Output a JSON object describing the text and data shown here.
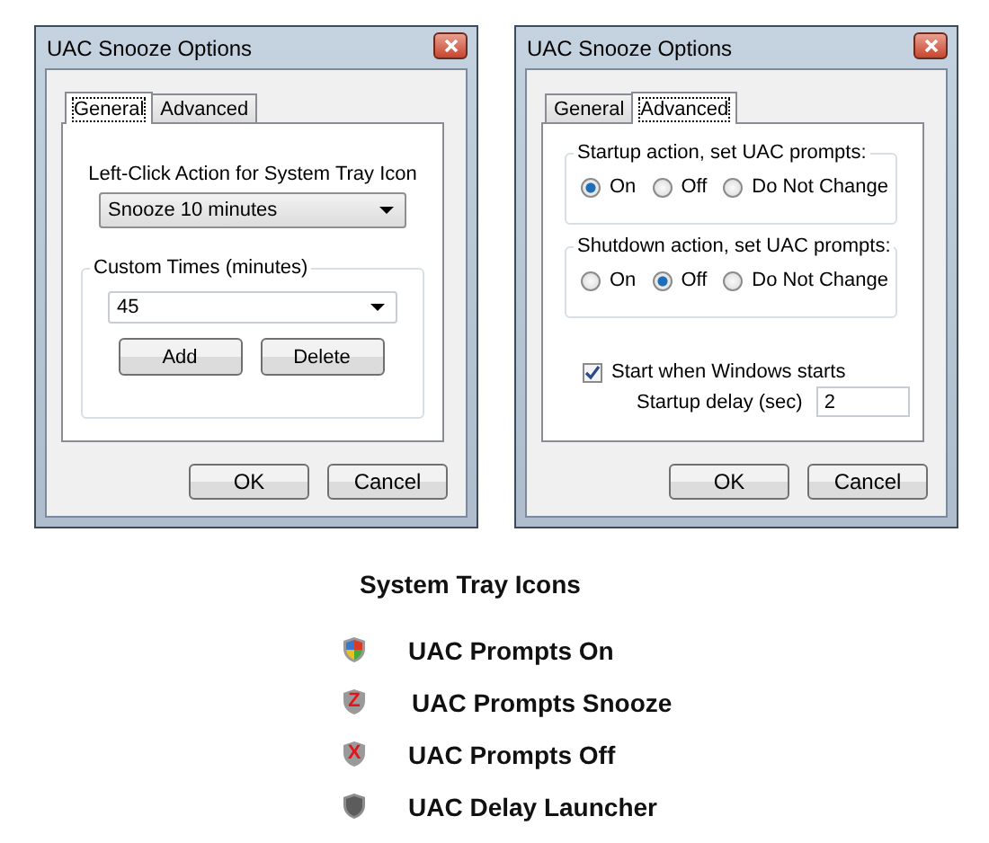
{
  "windows": [
    {
      "title": "UAC Snooze Options",
      "tabs": [
        {
          "label": "General",
          "selected": true
        },
        {
          "label": "Advanced",
          "selected": false
        }
      ],
      "panel": {
        "kind": "general",
        "action_label": "Left-Click Action for System Tray Icon",
        "action_value": "Snooze 10 minutes",
        "group_title": "Custom Times (minutes)",
        "times_value": "45",
        "group_buttons": [
          "Add",
          "Delete"
        ]
      },
      "buttons": [
        "OK",
        "Cancel"
      ]
    },
    {
      "title": "UAC Snooze Options",
      "tabs": [
        {
          "label": "General",
          "selected": false
        },
        {
          "label": "Advanced",
          "selected": true
        }
      ],
      "panel": {
        "kind": "advanced",
        "groups": [
          {
            "title": "Startup action, set UAC prompts:",
            "options": [
              {
                "label": "On",
                "selected": true
              },
              {
                "label": "Off",
                "selected": false
              },
              {
                "label": "Do Not Change",
                "selected": false
              }
            ]
          },
          {
            "title": "Shutdown action, set UAC prompts:",
            "options": [
              {
                "label": "On",
                "selected": false
              },
              {
                "label": "Off",
                "selected": true
              },
              {
                "label": "Do Not Change",
                "selected": false
              }
            ]
          }
        ],
        "start_checkbox": {
          "label": "Start when Windows starts",
          "checked": true
        },
        "delay": {
          "label": "Startup delay (sec)",
          "value": "2"
        }
      },
      "buttons": [
        "OK",
        "Cancel"
      ]
    }
  ],
  "legend": {
    "title": "System Tray Icons",
    "items": [
      {
        "kind": "on",
        "label": "UAC Prompts On"
      },
      {
        "kind": "snooze",
        "glyph": "Z",
        "label": "UAC Prompts Snooze"
      },
      {
        "kind": "off",
        "glyph": "X",
        "label": "UAC Prompts Off"
      },
      {
        "kind": "delay",
        "label": "UAC Delay Launcher"
      }
    ]
  }
}
